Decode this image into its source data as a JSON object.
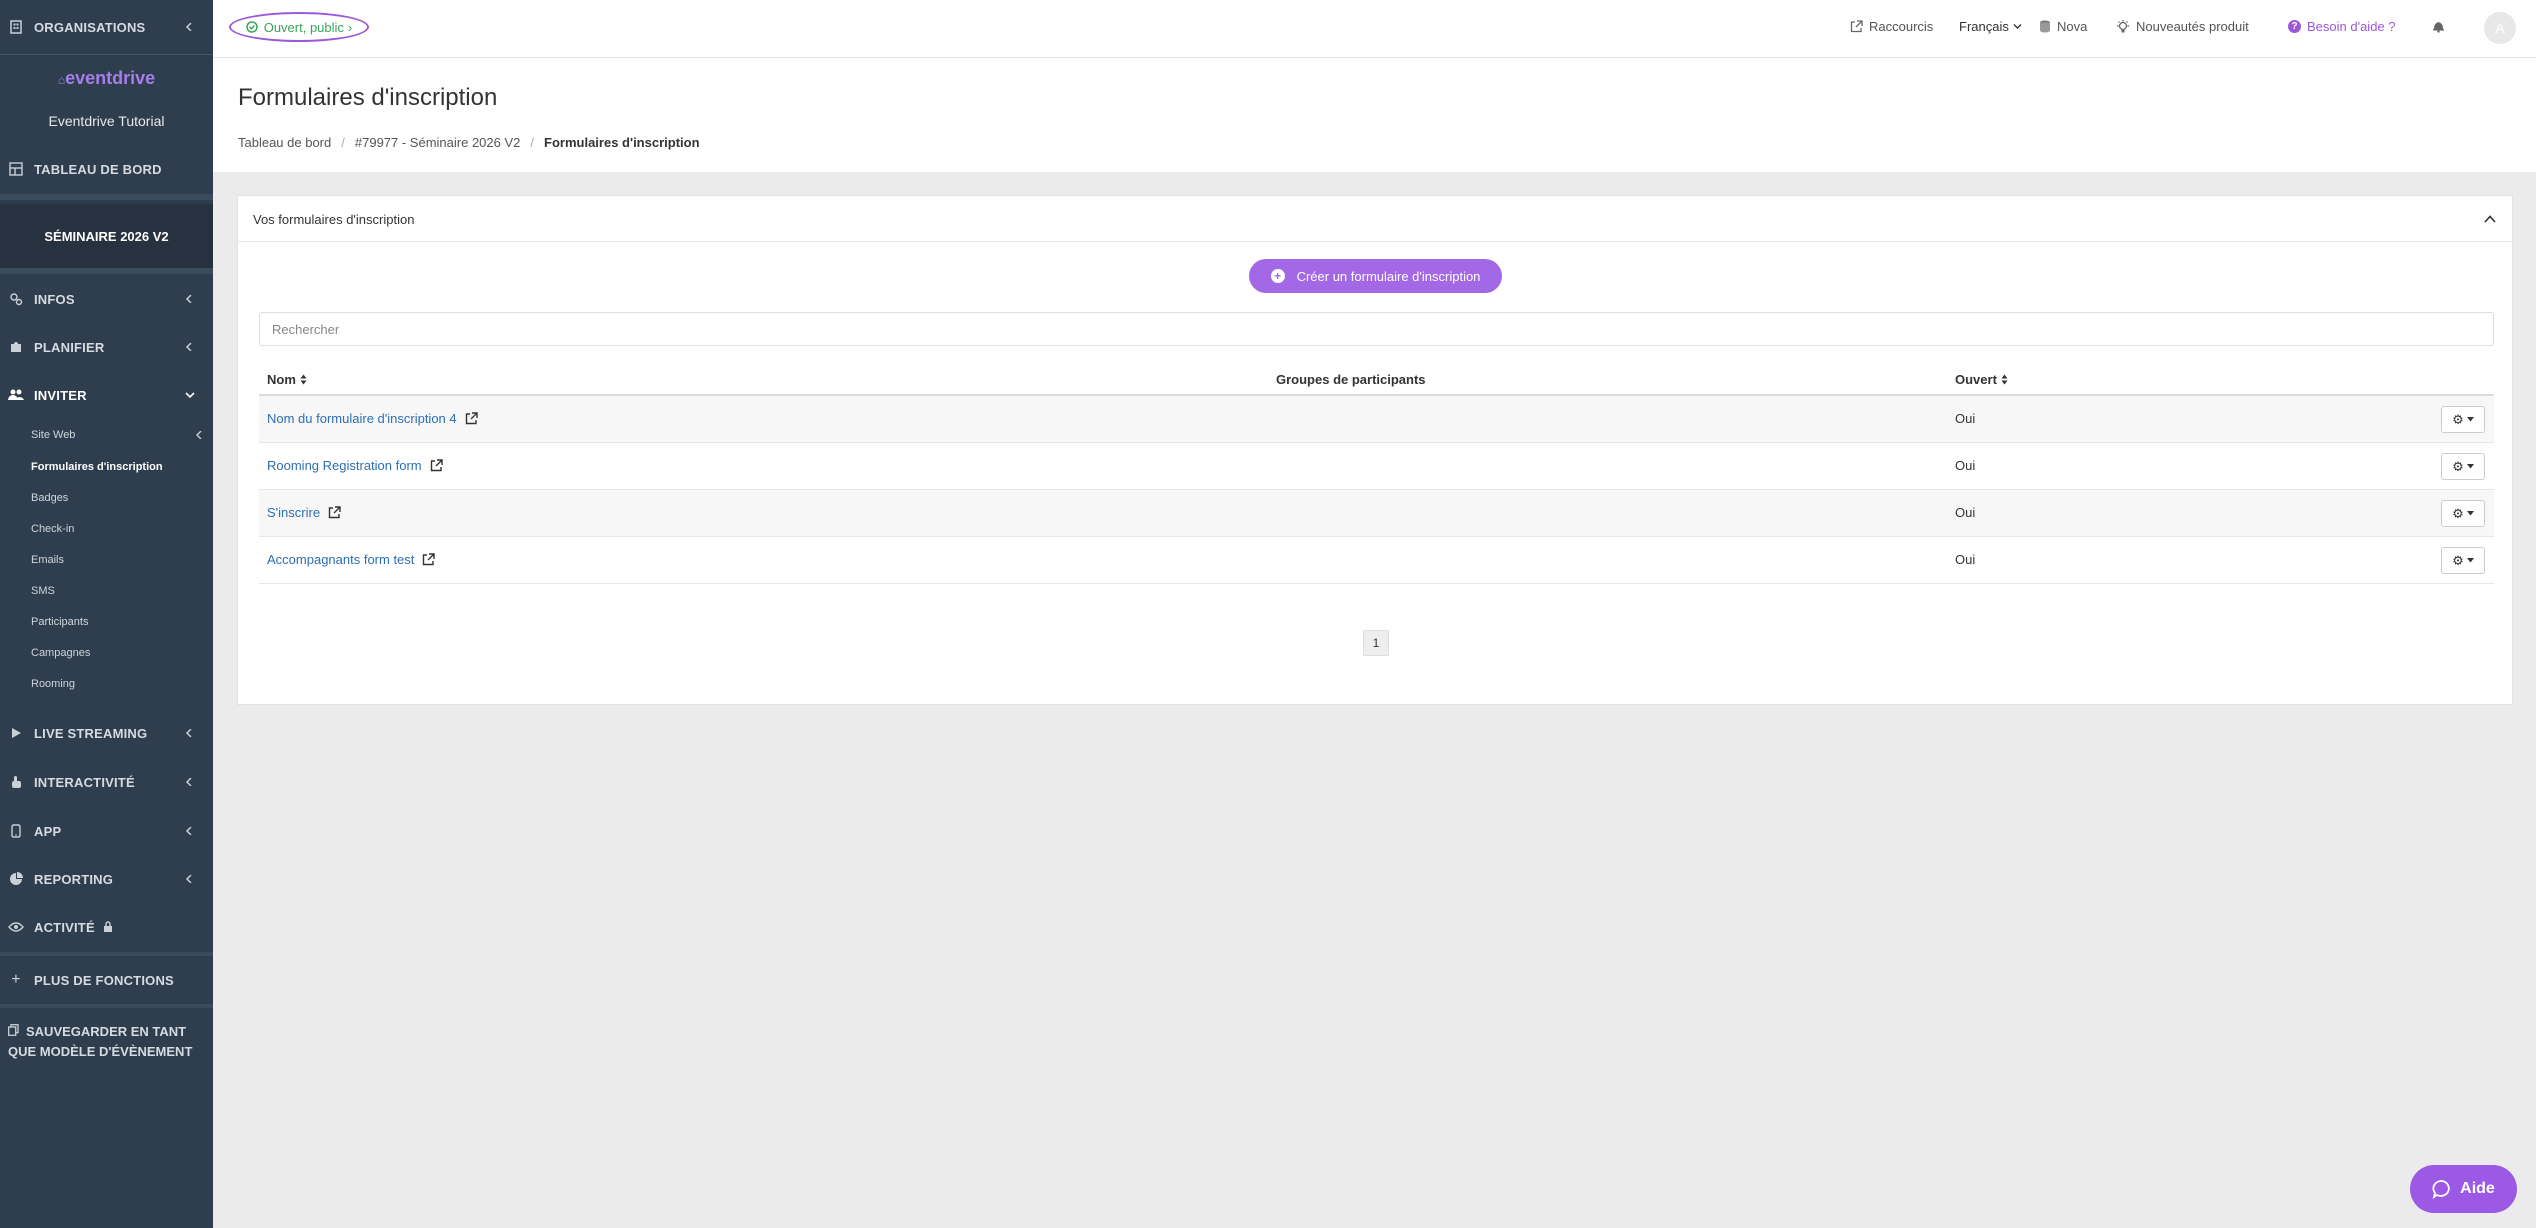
{
  "sidebar": {
    "organisations": "ORGANISATIONS",
    "logo": "eventdrive",
    "tutorial": "Eventdrive Tutorial",
    "dashboard": "TABLEAU DE BORD",
    "event_name": "SÉMINAIRE 2026 V2",
    "infos": "INFOS",
    "planifier": "PLANIFIER",
    "inviter": "INVITER",
    "subitems": [
      "Site Web",
      "Formulaires d'inscription",
      "Badges",
      "Check-in",
      "Emails",
      "SMS",
      "Participants",
      "Campagnes",
      "Rooming"
    ],
    "live": "LIVE STREAMING",
    "interactivite": "INTERACTIVITÉ",
    "app": "APP",
    "reporting": "REPORTING",
    "activite": "ACTIVITÉ",
    "plus": "PLUS DE FONCTIONS",
    "save_template": "SAUVEGARDER EN TANT QUE MODÈLE D'ÉVÈNEMENT"
  },
  "topbar": {
    "status": "Ouvert, public",
    "raccourcis": "Raccourcis",
    "language": "Français",
    "nova": "Nova",
    "nouveautes": "Nouveautés produit",
    "help": "Besoin d'aide ?",
    "avatar": "A"
  },
  "header": {
    "title": "Formulaires d'inscription",
    "breadcrumb": [
      "Tableau de bord",
      "#79977 - Séminaire 2026 V2",
      "Formulaires d'inscription"
    ]
  },
  "card": {
    "title": "Vos formulaires d'inscription",
    "create_label": "Créer un formulaire d'inscription",
    "search_placeholder": "Rechercher",
    "columns": {
      "name": "Nom",
      "groups": "Groupes de participants",
      "open": "Ouvert"
    },
    "rows": [
      {
        "name": "Nom du formulaire d'inscription 4",
        "groups": "",
        "open": "Oui"
      },
      {
        "name": "Rooming Registration form",
        "groups": "",
        "open": "Oui"
      },
      {
        "name": "S'inscrire",
        "groups": "",
        "open": "Oui"
      },
      {
        "name": "Accompagnants form test",
        "groups": "",
        "open": "Oui"
      }
    ],
    "page": "1"
  },
  "help_widget": "Aide",
  "colors": {
    "accent": "#a368e6",
    "sidebar": "#2f3e4e",
    "link": "#2c6fb3",
    "status": "#3aa55a"
  }
}
